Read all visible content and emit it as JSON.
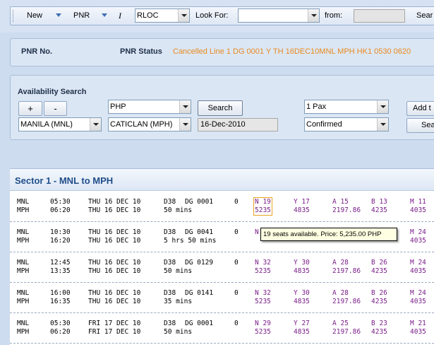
{
  "toolbar": {
    "new_label": "New",
    "pnr_label": "PNR",
    "italic_label": "I",
    "rloc_value": "RLOC",
    "look_for_label": "Look For:",
    "look_for_value": "",
    "from_label": "from:",
    "search_label": "Sear"
  },
  "pnr_bar": {
    "pnr_no_label": "PNR No.",
    "pnr_status_label": "PNR Status",
    "pnr_status_value": "Cancelled Line 1 DG 0001 Y TH 16DEC10MNL MPH HK1 0530 0620",
    "status_color": "#e8891e"
  },
  "availability": {
    "title": "Availability Search",
    "plus_label": "+",
    "minus_label": "-",
    "currency": "PHP",
    "search_button": "Search",
    "pax": "1 Pax",
    "add_label": "Add t",
    "origin": "MANILA (MNL)",
    "destination": "CATICLAN (MPH)",
    "date": "16-Dec-2010",
    "status": "Confirmed",
    "sea_label": "Sea"
  },
  "sector": {
    "title": "Sector 1 - MNL to MPH",
    "rows": [
      {
        "from": "MNL",
        "to": "MPH",
        "dep": "05:30",
        "arr": "06:20",
        "dep_date": "THU 16 DEC 10",
        "arr_date": "THU 16 DEC 10",
        "equip": "D38",
        "flight": "DG 0001",
        "duration": "50 mins",
        "stops": "0",
        "fares": [
          {
            "cls": "N 19",
            "price": "5235"
          },
          {
            "cls": "Y 17",
            "price": "4835"
          },
          {
            "cls": "A 15",
            "price": "2197.86"
          },
          {
            "cls": "B 13",
            "price": "4235"
          },
          {
            "cls": "M 11",
            "price": "4035"
          }
        ]
      },
      {
        "from": "MNL",
        "to": "MPH",
        "dep": "10:30",
        "arr": "16:20",
        "dep_date": "THU 16 DEC 10",
        "arr_date": "THU 16 DEC 10",
        "equip": "D38",
        "flight": "DG 0041",
        "duration": "5 hrs 50 mins",
        "stops": "0",
        "fares": [
          {
            "cls": "N",
            "price": ""
          },
          {
            "cls": "",
            "price": ""
          },
          {
            "cls": "",
            "price": ""
          },
          {
            "cls": "",
            "price": ""
          },
          {
            "cls": "M 24",
            "price": "4035"
          }
        ]
      },
      {
        "from": "MNL",
        "to": "MPH",
        "dep": "12:45",
        "arr": "13:35",
        "dep_date": "THU 16 DEC 10",
        "arr_date": "THU 16 DEC 10",
        "equip": "D38",
        "flight": "DG 0129",
        "duration": "50 mins",
        "stops": "0",
        "fares": [
          {
            "cls": "N 32",
            "price": "5235"
          },
          {
            "cls": "Y 30",
            "price": "4835"
          },
          {
            "cls": "A 28",
            "price": "2197.86"
          },
          {
            "cls": "B 26",
            "price": "4235"
          },
          {
            "cls": "M 24",
            "price": "4035"
          }
        ]
      },
      {
        "from": "MNL",
        "to": "MPH",
        "dep": "16:00",
        "arr": "16:35",
        "dep_date": "THU 16 DEC 10",
        "arr_date": "THU 16 DEC 10",
        "equip": "D38",
        "flight": "DG 0141",
        "duration": "35 mins",
        "stops": "0",
        "fares": [
          {
            "cls": "N 32",
            "price": "5235"
          },
          {
            "cls": "Y 30",
            "price": "4835"
          },
          {
            "cls": "A 28",
            "price": "2197.86"
          },
          {
            "cls": "B 26",
            "price": "4235"
          },
          {
            "cls": "M 24",
            "price": "4035"
          }
        ]
      },
      {
        "from": "MNL",
        "to": "MPH",
        "dep": "05:30",
        "arr": "06:20",
        "dep_date": "FRI 17 DEC 10",
        "arr_date": "FRI 17 DEC 10",
        "equip": "D38",
        "flight": "DG 0001",
        "duration": "50 mins",
        "stops": "0",
        "fares": [
          {
            "cls": "N 29",
            "price": "5235"
          },
          {
            "cls": "Y 27",
            "price": "4835"
          },
          {
            "cls": "A 25",
            "price": "2197.86"
          },
          {
            "cls": "B 23",
            "price": "4235"
          },
          {
            "cls": "M 21",
            "price": "4035"
          }
        ]
      }
    ]
  },
  "tooltip": "19 seats available. Price: 5,235.00 PHP",
  "colors": {
    "fare_text": "#7b1f8a",
    "sector_title": "#1f4d8a",
    "status_orange": "#e8891e"
  }
}
